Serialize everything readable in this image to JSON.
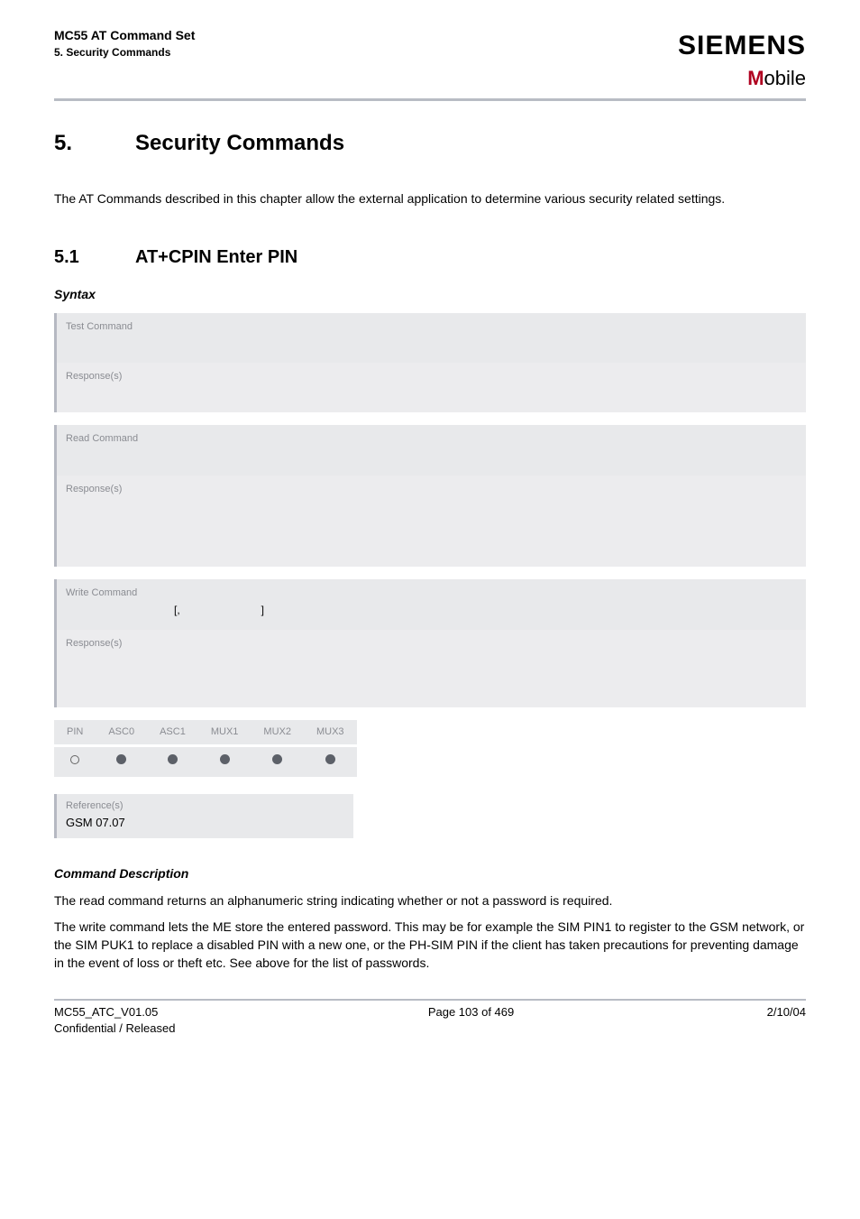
{
  "header": {
    "doc_title": "MC55 AT Command Set",
    "section_breadcrumb": "5. Security Commands",
    "brand": "SIEMENS",
    "brand_sub_m": "M",
    "brand_sub_rest": "obile"
  },
  "chapter": {
    "number": "5.",
    "title": "Security Commands",
    "intro": "The AT Commands described in this chapter allow the external application to determine various security related settings."
  },
  "section": {
    "number": "5.1",
    "title": "AT+CPIN   Enter PIN"
  },
  "syntax": {
    "label": "Syntax",
    "test": {
      "label": "Test Command",
      "content": ""
    },
    "test_resp": {
      "label": "Response(s)",
      "content": ""
    },
    "read": {
      "label": "Read Command",
      "content": ""
    },
    "read_resp": {
      "label": "Response(s)",
      "content": ""
    },
    "write": {
      "label": "Write Command",
      "content_prefix": "",
      "bracket_open": "[,",
      "bracket_close": "]"
    },
    "write_resp": {
      "label": "Response(s)",
      "content": ""
    }
  },
  "applies": {
    "cols": [
      "PIN",
      "ASC0",
      "ASC1",
      "MUX1",
      "MUX2",
      "MUX3"
    ],
    "row": [
      "open",
      "fill",
      "fill",
      "fill",
      "fill",
      "fill"
    ]
  },
  "reference": {
    "label": "Reference(s)",
    "value": "GSM 07.07"
  },
  "cmd_desc": {
    "label": "Command Description",
    "p1": "The read command returns an alphanumeric string indicating whether or not a password is required.",
    "p2": "The write command lets the ME store the entered password. This may be for example the SIM PIN1 to register to the GSM network, or the SIM PUK1 to replace a disabled PIN with a new one, or the PH-SIM PIN if the client has taken precautions for preventing damage in the event of loss or theft etc. See above for the list of passwords."
  },
  "footer": {
    "left1": "MC55_ATC_V01.05",
    "left2": "Confidential / Released",
    "center": "Page 103 of 469",
    "right": "2/10/04"
  }
}
